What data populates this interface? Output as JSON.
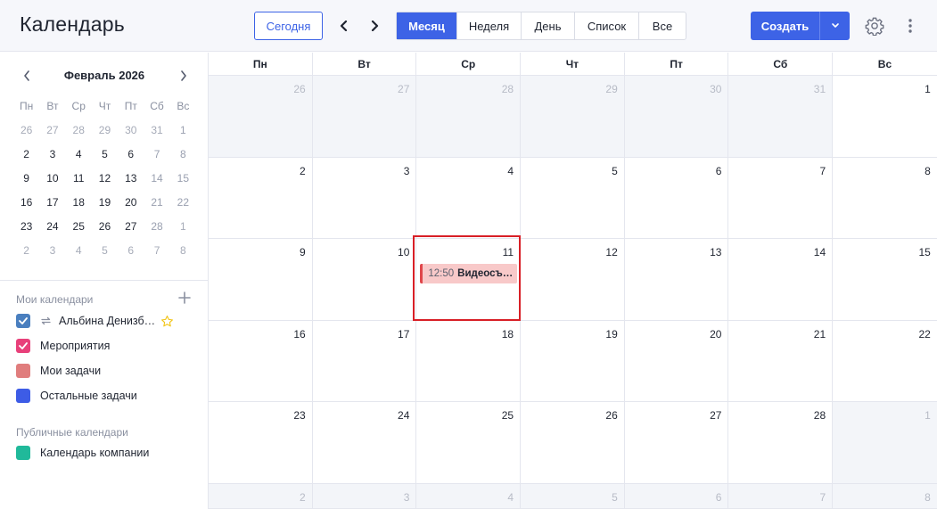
{
  "header": {
    "title": "Календарь",
    "today_label": "Сегодня",
    "views": [
      {
        "label": "Месяц",
        "active": true,
        "width": 68
      },
      {
        "label": "Неделя",
        "active": false,
        "width": 72
      },
      {
        "label": "День",
        "active": false,
        "width": 60
      },
      {
        "label": "Список",
        "active": false,
        "width": 72
      },
      {
        "label": "Все",
        "active": false,
        "width": 52
      }
    ],
    "create_label": "Создать",
    "accent_color": "#3d63e6"
  },
  "mini_calendar": {
    "title": "Февраль 2026",
    "weekdays": [
      "Пн",
      "Вт",
      "Ср",
      "Чт",
      "Пт",
      "Сб",
      "Вс"
    ],
    "weeks": [
      [
        "26",
        "27",
        "28",
        "29",
        "30",
        "31",
        "1"
      ],
      [
        "2",
        "3",
        "4",
        "5",
        "6",
        "7",
        "8"
      ],
      [
        "9",
        "10",
        "11",
        "12",
        "13",
        "14",
        "15"
      ],
      [
        "16",
        "17",
        "18",
        "19",
        "20",
        "21",
        "22"
      ],
      [
        "23",
        "24",
        "25",
        "26",
        "27",
        "28",
        "1"
      ],
      [
        "2",
        "3",
        "4",
        "5",
        "6",
        "7",
        "8"
      ]
    ]
  },
  "my_calendars": {
    "title": "Мои календари",
    "items": [
      {
        "label": "Альбина Денизб…",
        "color": "#4a7fbf",
        "checked": true,
        "sync": true,
        "starred": true
      },
      {
        "label": "Мероприятия",
        "color": "#e8407a",
        "checked": true,
        "sync": false,
        "starred": false
      },
      {
        "label": "Мои задачи",
        "color": "#e07d7d",
        "checked": false,
        "sync": false,
        "starred": false
      },
      {
        "label": "Остальные задачи",
        "color": "#3d5ce6",
        "checked": false,
        "sync": false,
        "starred": false
      }
    ]
  },
  "public_calendars": {
    "title": "Публичные календари",
    "items": [
      {
        "label": "Календарь компании",
        "color": "#20b99a",
        "checked": false
      }
    ]
  },
  "month": {
    "weekdays": [
      "Пн",
      "Вт",
      "Ср",
      "Чт",
      "Пт",
      "Сб",
      "Вс"
    ],
    "weeks": [
      [
        {
          "d": "26",
          "o": true
        },
        {
          "d": "27",
          "o": true
        },
        {
          "d": "28",
          "o": true
        },
        {
          "d": "29",
          "o": true
        },
        {
          "d": "30",
          "o": true
        },
        {
          "d": "31",
          "o": true
        },
        {
          "d": "1",
          "o": false
        }
      ],
      [
        {
          "d": "2",
          "o": false
        },
        {
          "d": "3",
          "o": false
        },
        {
          "d": "4",
          "o": false
        },
        {
          "d": "5",
          "o": false
        },
        {
          "d": "6",
          "o": false
        },
        {
          "d": "7",
          "o": false
        },
        {
          "d": "8",
          "o": false
        }
      ],
      [
        {
          "d": "9",
          "o": false
        },
        {
          "d": "10",
          "o": false
        },
        {
          "d": "11",
          "o": false
        },
        {
          "d": "12",
          "o": false
        },
        {
          "d": "13",
          "o": false
        },
        {
          "d": "14",
          "o": false
        },
        {
          "d": "15",
          "o": false
        }
      ],
      [
        {
          "d": "16",
          "o": false
        },
        {
          "d": "17",
          "o": false
        },
        {
          "d": "18",
          "o": false
        },
        {
          "d": "19",
          "o": false
        },
        {
          "d": "20",
          "o": false
        },
        {
          "d": "21",
          "o": false
        },
        {
          "d": "22",
          "o": false
        }
      ],
      [
        {
          "d": "23",
          "o": false
        },
        {
          "d": "24",
          "o": false
        },
        {
          "d": "25",
          "o": false
        },
        {
          "d": "26",
          "o": false
        },
        {
          "d": "27",
          "o": false
        },
        {
          "d": "28",
          "o": false
        },
        {
          "d": "1",
          "o": true
        }
      ],
      [
        {
          "d": "2",
          "o": true
        },
        {
          "d": "3",
          "o": true
        },
        {
          "d": "4",
          "o": true
        },
        {
          "d": "5",
          "o": true
        },
        {
          "d": "6",
          "o": true
        },
        {
          "d": "7",
          "o": true
        },
        {
          "d": "8",
          "o": true
        }
      ]
    ],
    "event": {
      "week": 2,
      "day": 2,
      "time": "12:50",
      "title": "Видеосъ…",
      "color": "#e0474b"
    }
  }
}
